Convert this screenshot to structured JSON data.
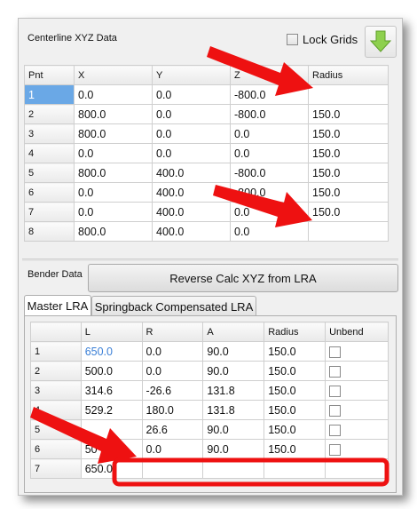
{
  "centerline": {
    "title": "Centerline XYZ Data",
    "lock_grids_label": "Lock Grids",
    "download_icon": "green-down-arrow-icon",
    "columns": [
      "Pnt",
      "X",
      "Y",
      "Z",
      "Radius"
    ],
    "rows": [
      [
        "1",
        "0.0",
        "0.0",
        "-800.0",
        ""
      ],
      [
        "2",
        "800.0",
        "0.0",
        "-800.0",
        "150.0"
      ],
      [
        "3",
        "800.0",
        "0.0",
        "0.0",
        "150.0"
      ],
      [
        "4",
        "0.0",
        "0.0",
        "0.0",
        "150.0"
      ],
      [
        "5",
        "800.0",
        "400.0",
        "-800.0",
        "150.0"
      ],
      [
        "6",
        "0.0",
        "400.0",
        "-800.0",
        "150.0"
      ],
      [
        "7",
        "0.0",
        "400.0",
        "0.0",
        "150.0"
      ],
      [
        "8",
        "800.0",
        "400.0",
        "0.0",
        ""
      ]
    ]
  },
  "bender": {
    "title": "Bender Data",
    "reverse_button": "Reverse Calc XYZ from LRA",
    "tabs": [
      "Master LRA",
      "Springback Compensated LRA"
    ],
    "columns": [
      "",
      "L",
      "R",
      "A",
      "Radius",
      "Unbend"
    ],
    "rows": [
      [
        "1",
        "650.0",
        "0.0",
        "90.0",
        "150.0"
      ],
      [
        "2",
        "500.0",
        "0.0",
        "90.0",
        "150.0"
      ],
      [
        "3",
        "314.6",
        "-26.6",
        "131.8",
        "150.0"
      ],
      [
        "4",
        "529.2",
        "180.0",
        "131.8",
        "150.0"
      ],
      [
        "5",
        "",
        "26.6",
        "90.0",
        "150.0"
      ],
      [
        "6",
        "50",
        "0.0",
        "90.0",
        "150.0"
      ],
      [
        "7",
        "650.0",
        "",
        "",
        "",
        ""
      ]
    ]
  },
  "colors": {
    "annotation_red": "#ee1111",
    "selection_blue": "#6aa8e6"
  }
}
